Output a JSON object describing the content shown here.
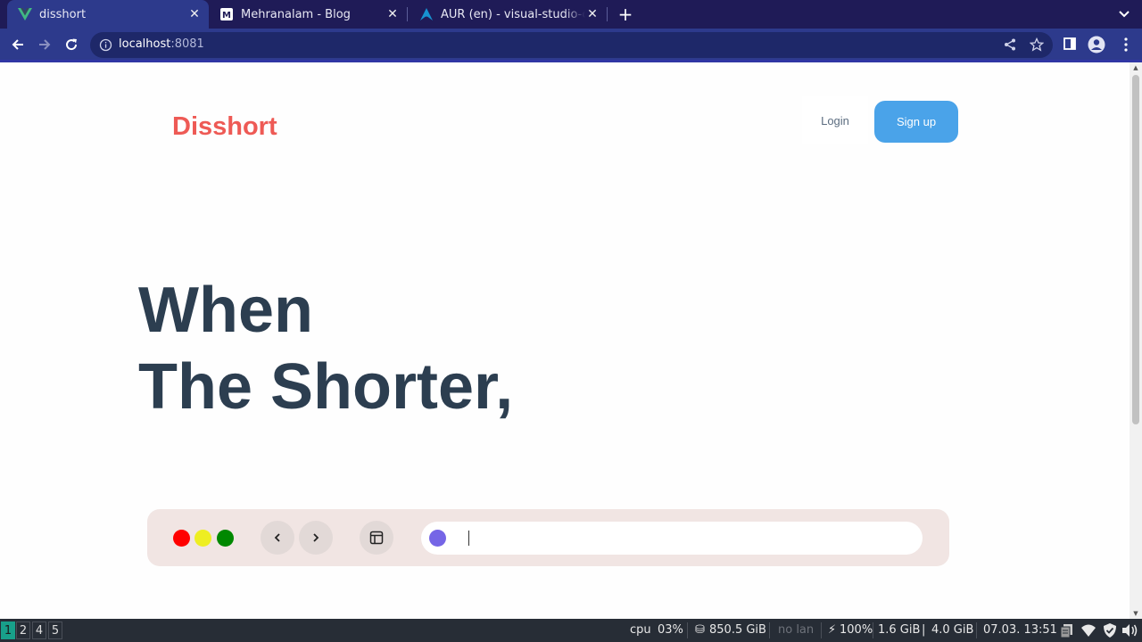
{
  "browser": {
    "tabs": [
      {
        "title": "disshort",
        "icon": "vue-icon",
        "active": true
      },
      {
        "title": "Mehranalam - Blog",
        "icon": "m-icon",
        "active": false
      },
      {
        "title": "AUR (en) - visual-studio-code",
        "icon": "arch-icon",
        "active": false
      }
    ],
    "url_host": "localhost",
    "url_port": ":8081"
  },
  "page": {
    "brand": "Disshort",
    "login_label": "Login",
    "signup_label": "Sign up",
    "hero_line_1": "When",
    "hero_line_2": "The Shorter,",
    "search_value": ""
  },
  "colors": {
    "brand": "#ee5a55",
    "signup_bg": "#4aa3e9",
    "hero_text": "#2c3e50",
    "dot_red": "#ff0000",
    "dot_yellow": "#eeee22",
    "dot_green": "#008800",
    "search_bullet": "#7565e6"
  },
  "taskbar": {
    "workspaces": [
      "1",
      "2",
      "4",
      "5"
    ],
    "active_workspace": "1",
    "cpu_label": "cpu",
    "cpu_value": "03%",
    "disk": "850.5 GiB",
    "lan": "no lan",
    "battery": "100%",
    "mem_used": "1.6 GiB",
    "mem_total": "4.0 GiB",
    "datetime": "07.03. 13:51"
  }
}
